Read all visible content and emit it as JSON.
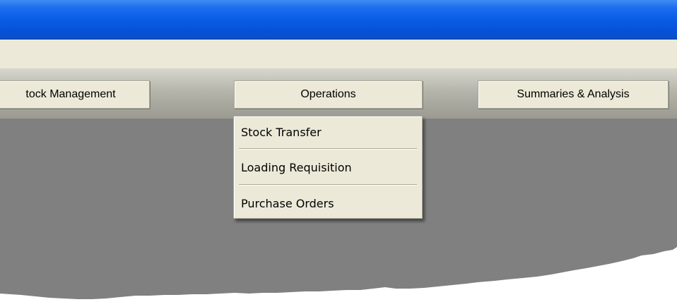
{
  "toolbar": {
    "stock_management": "tock Management",
    "operations": "Operations",
    "summaries": "Summaries & Analysis"
  },
  "operations_menu": {
    "items": [
      "Stock Transfer",
      "Loading Requisition",
      "Purchase Orders"
    ]
  },
  "colors": {
    "titlebar": "#0a5ce6",
    "menubar": "#ece9d8",
    "workspace": "#808080"
  }
}
